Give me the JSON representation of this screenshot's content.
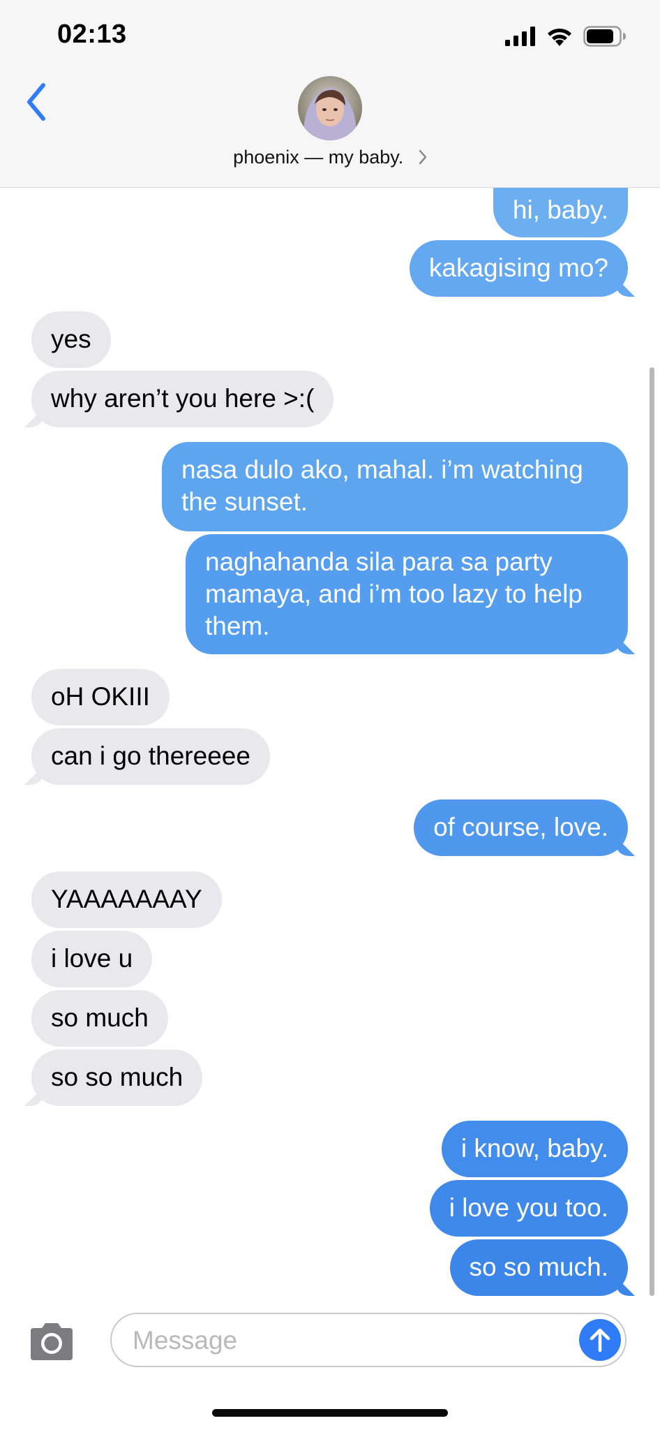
{
  "status_bar": {
    "time": "02:13"
  },
  "header": {
    "contact_name": "phoenix — my baby."
  },
  "messages": [
    {
      "from": "me",
      "text": "hi, baby."
    },
    {
      "from": "me",
      "text": "kakagising mo?"
    },
    {
      "from": "them",
      "text": "yes"
    },
    {
      "from": "them",
      "text": "why aren’t you here >:("
    },
    {
      "from": "me",
      "text": "nasa dulo ako, mahal. i’m watching the sunset."
    },
    {
      "from": "me",
      "text": "naghahanda sila para sa party mamaya, and i’m too lazy to help them."
    },
    {
      "from": "them",
      "text": "oH OKIII"
    },
    {
      "from": "them",
      "text": "can i go thereeee"
    },
    {
      "from": "me",
      "text": "of course, love."
    },
    {
      "from": "them",
      "text": "YAAAAAAAY"
    },
    {
      "from": "them",
      "text": "i love u"
    },
    {
      "from": "them",
      "text": "so much"
    },
    {
      "from": "them",
      "text": "so so much"
    },
    {
      "from": "me",
      "text": "i know, baby."
    },
    {
      "from": "me",
      "text": "i love you too."
    },
    {
      "from": "me",
      "text": "so so much."
    }
  ],
  "composer": {
    "placeholder": "Message",
    "value": ""
  },
  "icons": {
    "back": "chevron-left-icon",
    "camera": "camera-icon",
    "send": "arrow-up-icon",
    "signal": "cellular-signal-icon",
    "wifi": "wifi-icon",
    "battery": "battery-icon"
  },
  "colors": {
    "accent": "#2f7cf6",
    "sent_bubble": "#4c95ec",
    "received_bubble": "#e8e8ed"
  }
}
